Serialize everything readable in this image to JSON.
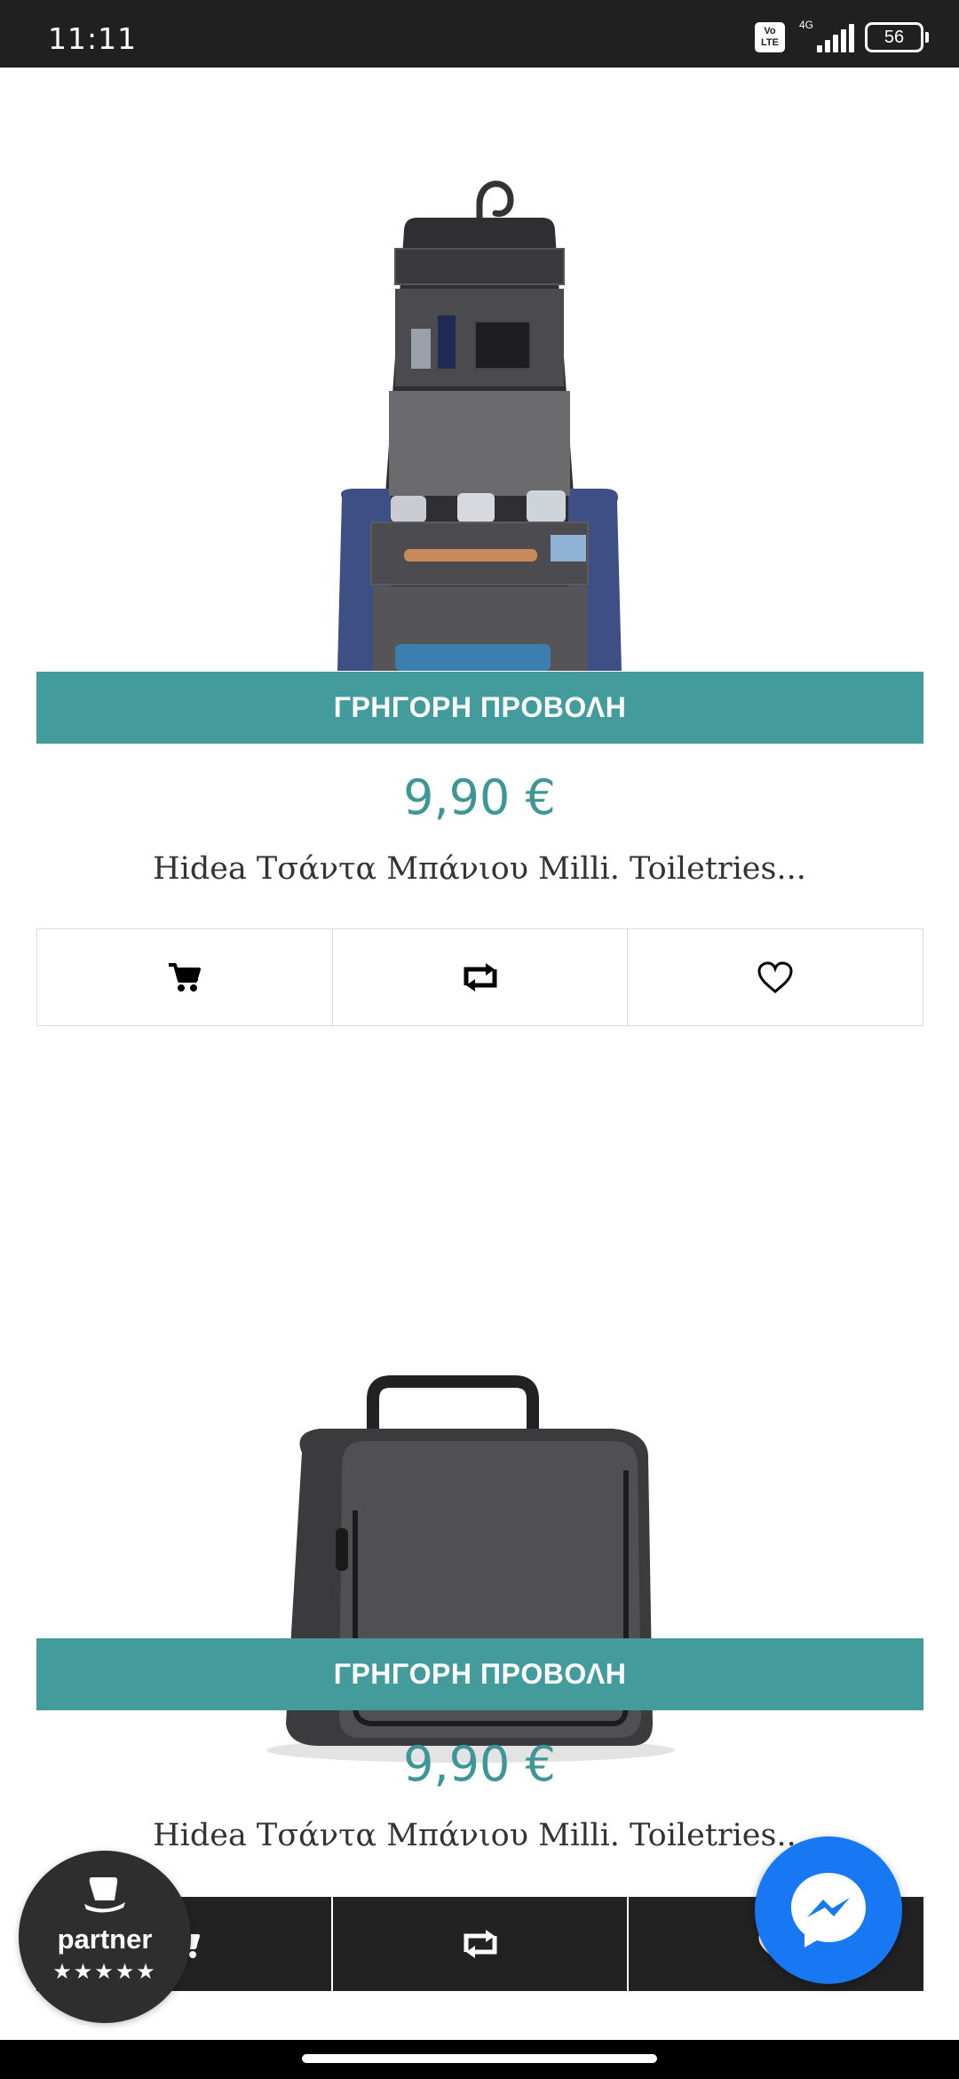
{
  "status_bar": {
    "time": "11:11",
    "volte": [
      "Vo",
      "LTE"
    ],
    "network": "4G",
    "battery": "56"
  },
  "products": [
    {
      "quick_view_label": "ΓΡΗΓΟΡΗ ΠΡΟΒΟΛΗ",
      "price": "9,90 €",
      "title": "Hidea Τσάντα Μπάνιου Milli. Toiletries...",
      "actions": [
        "cart-icon",
        "compare-icon",
        "heart-icon"
      ]
    },
    {
      "quick_view_label": "ΓΡΗΓΟΡΗ ΠΡΟΒΟΛΗ",
      "price": "9,90 €",
      "title": "Hidea Τσάντα Μπάνιου Milli. Toiletries...",
      "actions": [
        "cart-icon",
        "compare-icon",
        "heart-icon"
      ]
    }
  ],
  "partner_badge": {
    "label": "partner",
    "stars": "★★★★★"
  },
  "colors": {
    "accent": "#439b9b",
    "price": "#3f9696",
    "messenger": "#1877f2",
    "dark_row": "#222222"
  }
}
